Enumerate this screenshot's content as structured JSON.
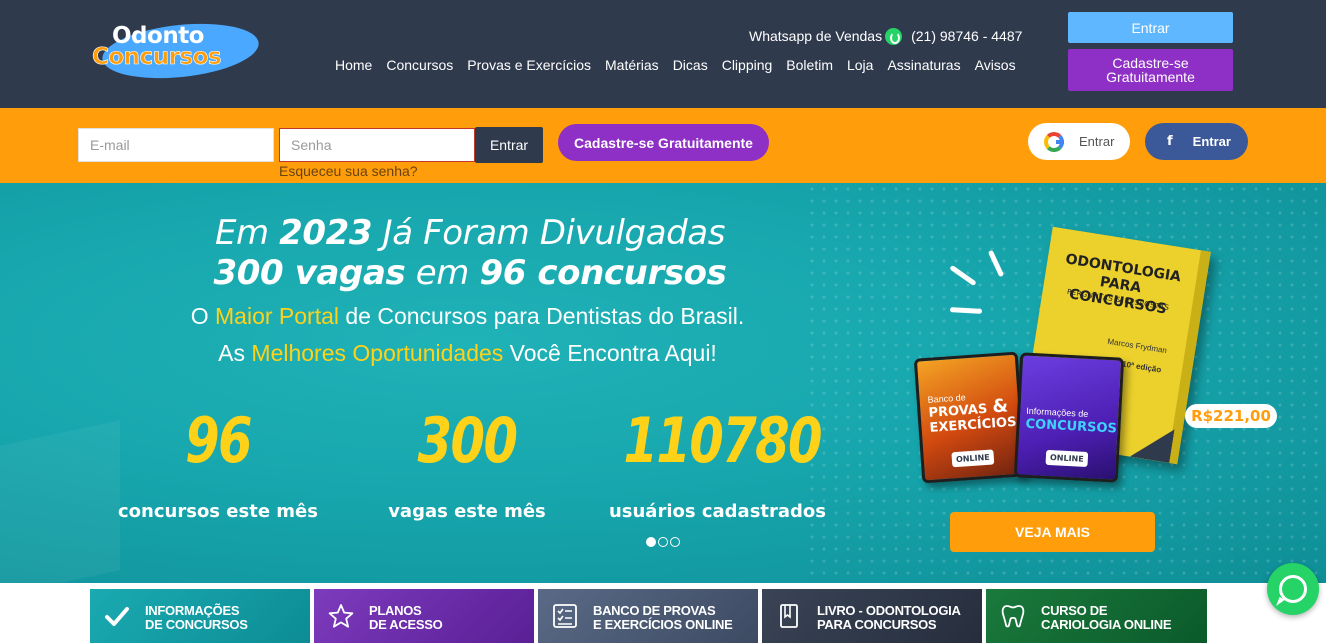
{
  "header": {
    "logo_line1": "Odonto",
    "logo_line2": "Concursos",
    "whatsapp_label": "Whatsapp de Vendas",
    "whatsapp_phone": "(21) 98746 - 4487",
    "nav": [
      {
        "label": "Home"
      },
      {
        "label": "Concursos"
      },
      {
        "label": "Provas e Exercícios"
      },
      {
        "label": "Matérias"
      },
      {
        "label": "Dicas"
      },
      {
        "label": "Clipping"
      },
      {
        "label": "Boletim"
      },
      {
        "label": "Loja"
      },
      {
        "label": "Assinaturas"
      },
      {
        "label": "Avisos"
      }
    ],
    "login_button": "Entrar",
    "signup_button": "Cadastre-se Gratuitamente"
  },
  "login_bar": {
    "email_placeholder": "E-mail",
    "password_placeholder": "Senha",
    "submit_label": "Entrar",
    "forgot_label": "Esqueceu sua senha?",
    "signup_label": "Cadastre-se Gratuitamente",
    "google_label": "Entrar",
    "facebook_label": "Entrar"
  },
  "hero": {
    "line1_pre": "Em ",
    "line1_year": "2023",
    "line1_post": " Já Foram Divulgadas",
    "line2_vagas": "300 vagas",
    "line2_mid": " em ",
    "line2_concursos": "96 concursos",
    "sub1_pre": "O ",
    "sub1_hl": "Maior Portal",
    "sub1_post": " de Concursos para Dentistas do Brasil.",
    "sub2_pre": "As ",
    "sub2_hl": "Melhores Oportunidades",
    "sub2_post": " Você Encontra Aqui!",
    "stats": [
      {
        "value": "96",
        "label": "concursos este mês"
      },
      {
        "value": "300",
        "label": "vagas este mês"
      },
      {
        "value": "110780",
        "label": "usuários cadastrados"
      }
    ],
    "carousel_active": 1,
    "carousel_total": 3
  },
  "promo": {
    "book_title": "ODONTOLOGIA PARA CONCURSOS",
    "book_subtitle": "PERGUNTAS & RESPOSTAS",
    "book_author": "Marcos Frydman",
    "book_edition": "10ª edição",
    "card_a_top": "Banco de",
    "card_a_title": "PROVAS EXERCÍCIOS",
    "card_a_amp": "&",
    "card_b_top": "Informações de",
    "card_b_title": "CONCURSOS",
    "badge": "ONLINE",
    "price": "R$221,00",
    "cta": "VEJA MAIS"
  },
  "tiles": [
    {
      "label": "INFORMAÇÕES\nDE CONCURSOS",
      "icon": "check-icon"
    },
    {
      "label": "PLANOS\nDE ACESSO",
      "icon": "star-icon"
    },
    {
      "label": "BANCO DE PROVAS\nE EXERCÍCIOS ONLINE",
      "icon": "checklist-icon"
    },
    {
      "label": "LIVRO - ODONTOLOGIA\nPARA CONCURSOS",
      "icon": "book-icon"
    },
    {
      "label": "CURSO DE\nCARIOLOGIA ONLINE",
      "icon": "tooth-icon"
    }
  ],
  "colors": {
    "header_bg": "#2f3a4d",
    "accent_orange": "#ff9d0a",
    "accent_purple": "#8e2fc5",
    "hero_teal": "#17a6ad",
    "highlight_yellow": "#ffd21a"
  }
}
